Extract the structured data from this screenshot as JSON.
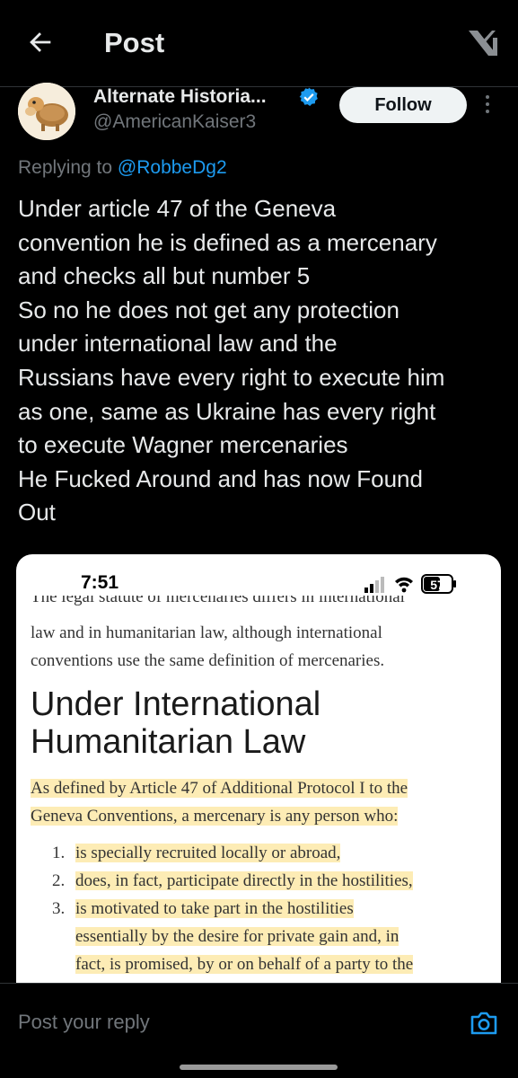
{
  "header": {
    "title": "Post",
    "back_icon": "arrow-left-icon",
    "logo_icon": "x-logo-icon"
  },
  "author": {
    "display_name": "Alternate Historia...",
    "handle": "@AmericanKaiser3",
    "verified": true,
    "follow_label": "Follow"
  },
  "reply_to": {
    "prefix": "Replying to ",
    "handle": "@RobbeDg2"
  },
  "tweet": {
    "lines": [
      "Under article 47 of the Geneva",
      "convention he is defined as a mercenary",
      "and checks all but number 5",
      "So no he does not get any protection",
      "under international law and the",
      "Russians have every right to execute him",
      "as one, same as Ukraine has every right",
      "to execute Wagner mercenaries",
      "He Fucked Around and has now Found",
      "Out"
    ]
  },
  "media": {
    "time": "7:51",
    "battery": "57",
    "cut_line": "The legal statute of mercenaries differs in international",
    "paragraph_lines": [
      "law and in humanitarian law, although international",
      "conventions use the same definition of mercenaries."
    ],
    "heading_lines": [
      "Under International",
      "Humanitarian Law"
    ],
    "definition_lines": [
      "As defined by Article 47 of Additional Protocol I to the",
      "Geneva Conventions, a mercenary is any person who:"
    ],
    "list": [
      {
        "num": "1.",
        "lines": [
          "is specially recruited locally or abroad,"
        ]
      },
      {
        "num": "2.",
        "lines": [
          "does, in fact, participate directly in the hostilities,"
        ]
      },
      {
        "num": "3.",
        "lines": [
          "is motivated to take part in the hostilities",
          "essentially by the desire for private gain and, in",
          "fact, is promised, by or on behalf of a party to the"
        ]
      }
    ]
  },
  "composer": {
    "placeholder": "Post your reply",
    "camera_icon": "camera-icon"
  },
  "colors": {
    "accent": "#1d9bf0",
    "highlight": "#fdecb5",
    "background": "#000000"
  }
}
